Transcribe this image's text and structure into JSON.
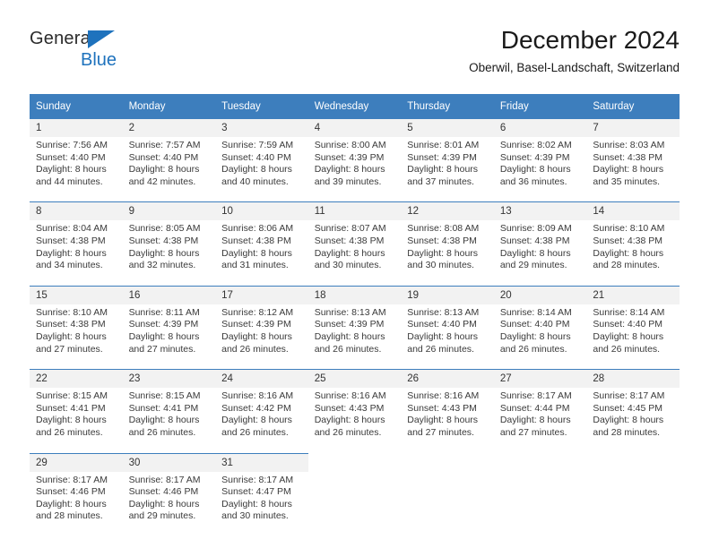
{
  "brand": {
    "name_part1": "General",
    "name_part2": "Blue",
    "accent_color": "#1e72bd"
  },
  "header": {
    "title": "December 2024",
    "subtitle": "Oberwil, Basel-Landschaft, Switzerland"
  },
  "calendar": {
    "header_bg": "#3d7ebd",
    "daynum_bg": "#f2f2f2",
    "weekdays": [
      "Sunday",
      "Monday",
      "Tuesday",
      "Wednesday",
      "Thursday",
      "Friday",
      "Saturday"
    ],
    "weeks": [
      [
        {
          "day": "1",
          "sunrise": "Sunrise: 7:56 AM",
          "sunset": "Sunset: 4:40 PM",
          "daylight_line1": "Daylight: 8 hours",
          "daylight_line2": "and 44 minutes."
        },
        {
          "day": "2",
          "sunrise": "Sunrise: 7:57 AM",
          "sunset": "Sunset: 4:40 PM",
          "daylight_line1": "Daylight: 8 hours",
          "daylight_line2": "and 42 minutes."
        },
        {
          "day": "3",
          "sunrise": "Sunrise: 7:59 AM",
          "sunset": "Sunset: 4:40 PM",
          "daylight_line1": "Daylight: 8 hours",
          "daylight_line2": "and 40 minutes."
        },
        {
          "day": "4",
          "sunrise": "Sunrise: 8:00 AM",
          "sunset": "Sunset: 4:39 PM",
          "daylight_line1": "Daylight: 8 hours",
          "daylight_line2": "and 39 minutes."
        },
        {
          "day": "5",
          "sunrise": "Sunrise: 8:01 AM",
          "sunset": "Sunset: 4:39 PM",
          "daylight_line1": "Daylight: 8 hours",
          "daylight_line2": "and 37 minutes."
        },
        {
          "day": "6",
          "sunrise": "Sunrise: 8:02 AM",
          "sunset": "Sunset: 4:39 PM",
          "daylight_line1": "Daylight: 8 hours",
          "daylight_line2": "and 36 minutes."
        },
        {
          "day": "7",
          "sunrise": "Sunrise: 8:03 AM",
          "sunset": "Sunset: 4:38 PM",
          "daylight_line1": "Daylight: 8 hours",
          "daylight_line2": "and 35 minutes."
        }
      ],
      [
        {
          "day": "8",
          "sunrise": "Sunrise: 8:04 AM",
          "sunset": "Sunset: 4:38 PM",
          "daylight_line1": "Daylight: 8 hours",
          "daylight_line2": "and 34 minutes."
        },
        {
          "day": "9",
          "sunrise": "Sunrise: 8:05 AM",
          "sunset": "Sunset: 4:38 PM",
          "daylight_line1": "Daylight: 8 hours",
          "daylight_line2": "and 32 minutes."
        },
        {
          "day": "10",
          "sunrise": "Sunrise: 8:06 AM",
          "sunset": "Sunset: 4:38 PM",
          "daylight_line1": "Daylight: 8 hours",
          "daylight_line2": "and 31 minutes."
        },
        {
          "day": "11",
          "sunrise": "Sunrise: 8:07 AM",
          "sunset": "Sunset: 4:38 PM",
          "daylight_line1": "Daylight: 8 hours",
          "daylight_line2": "and 30 minutes."
        },
        {
          "day": "12",
          "sunrise": "Sunrise: 8:08 AM",
          "sunset": "Sunset: 4:38 PM",
          "daylight_line1": "Daylight: 8 hours",
          "daylight_line2": "and 30 minutes."
        },
        {
          "day": "13",
          "sunrise": "Sunrise: 8:09 AM",
          "sunset": "Sunset: 4:38 PM",
          "daylight_line1": "Daylight: 8 hours",
          "daylight_line2": "and 29 minutes."
        },
        {
          "day": "14",
          "sunrise": "Sunrise: 8:10 AM",
          "sunset": "Sunset: 4:38 PM",
          "daylight_line1": "Daylight: 8 hours",
          "daylight_line2": "and 28 minutes."
        }
      ],
      [
        {
          "day": "15",
          "sunrise": "Sunrise: 8:10 AM",
          "sunset": "Sunset: 4:38 PM",
          "daylight_line1": "Daylight: 8 hours",
          "daylight_line2": "and 27 minutes."
        },
        {
          "day": "16",
          "sunrise": "Sunrise: 8:11 AM",
          "sunset": "Sunset: 4:39 PM",
          "daylight_line1": "Daylight: 8 hours",
          "daylight_line2": "and 27 minutes."
        },
        {
          "day": "17",
          "sunrise": "Sunrise: 8:12 AM",
          "sunset": "Sunset: 4:39 PM",
          "daylight_line1": "Daylight: 8 hours",
          "daylight_line2": "and 26 minutes."
        },
        {
          "day": "18",
          "sunrise": "Sunrise: 8:13 AM",
          "sunset": "Sunset: 4:39 PM",
          "daylight_line1": "Daylight: 8 hours",
          "daylight_line2": "and 26 minutes."
        },
        {
          "day": "19",
          "sunrise": "Sunrise: 8:13 AM",
          "sunset": "Sunset: 4:40 PM",
          "daylight_line1": "Daylight: 8 hours",
          "daylight_line2": "and 26 minutes."
        },
        {
          "day": "20",
          "sunrise": "Sunrise: 8:14 AM",
          "sunset": "Sunset: 4:40 PM",
          "daylight_line1": "Daylight: 8 hours",
          "daylight_line2": "and 26 minutes."
        },
        {
          "day": "21",
          "sunrise": "Sunrise: 8:14 AM",
          "sunset": "Sunset: 4:40 PM",
          "daylight_line1": "Daylight: 8 hours",
          "daylight_line2": "and 26 minutes."
        }
      ],
      [
        {
          "day": "22",
          "sunrise": "Sunrise: 8:15 AM",
          "sunset": "Sunset: 4:41 PM",
          "daylight_line1": "Daylight: 8 hours",
          "daylight_line2": "and 26 minutes."
        },
        {
          "day": "23",
          "sunrise": "Sunrise: 8:15 AM",
          "sunset": "Sunset: 4:41 PM",
          "daylight_line1": "Daylight: 8 hours",
          "daylight_line2": "and 26 minutes."
        },
        {
          "day": "24",
          "sunrise": "Sunrise: 8:16 AM",
          "sunset": "Sunset: 4:42 PM",
          "daylight_line1": "Daylight: 8 hours",
          "daylight_line2": "and 26 minutes."
        },
        {
          "day": "25",
          "sunrise": "Sunrise: 8:16 AM",
          "sunset": "Sunset: 4:43 PM",
          "daylight_line1": "Daylight: 8 hours",
          "daylight_line2": "and 26 minutes."
        },
        {
          "day": "26",
          "sunrise": "Sunrise: 8:16 AM",
          "sunset": "Sunset: 4:43 PM",
          "daylight_line1": "Daylight: 8 hours",
          "daylight_line2": "and 27 minutes."
        },
        {
          "day": "27",
          "sunrise": "Sunrise: 8:17 AM",
          "sunset": "Sunset: 4:44 PM",
          "daylight_line1": "Daylight: 8 hours",
          "daylight_line2": "and 27 minutes."
        },
        {
          "day": "28",
          "sunrise": "Sunrise: 8:17 AM",
          "sunset": "Sunset: 4:45 PM",
          "daylight_line1": "Daylight: 8 hours",
          "daylight_line2": "and 28 minutes."
        }
      ],
      [
        {
          "day": "29",
          "sunrise": "Sunrise: 8:17 AM",
          "sunset": "Sunset: 4:46 PM",
          "daylight_line1": "Daylight: 8 hours",
          "daylight_line2": "and 28 minutes."
        },
        {
          "day": "30",
          "sunrise": "Sunrise: 8:17 AM",
          "sunset": "Sunset: 4:46 PM",
          "daylight_line1": "Daylight: 8 hours",
          "daylight_line2": "and 29 minutes."
        },
        {
          "day": "31",
          "sunrise": "Sunrise: 8:17 AM",
          "sunset": "Sunset: 4:47 PM",
          "daylight_line1": "Daylight: 8 hours",
          "daylight_line2": "and 30 minutes."
        },
        {
          "day": "",
          "sunrise": "",
          "sunset": "",
          "daylight_line1": "",
          "daylight_line2": ""
        },
        {
          "day": "",
          "sunrise": "",
          "sunset": "",
          "daylight_line1": "",
          "daylight_line2": ""
        },
        {
          "day": "",
          "sunrise": "",
          "sunset": "",
          "daylight_line1": "",
          "daylight_line2": ""
        },
        {
          "day": "",
          "sunrise": "",
          "sunset": "",
          "daylight_line1": "",
          "daylight_line2": ""
        }
      ]
    ]
  }
}
